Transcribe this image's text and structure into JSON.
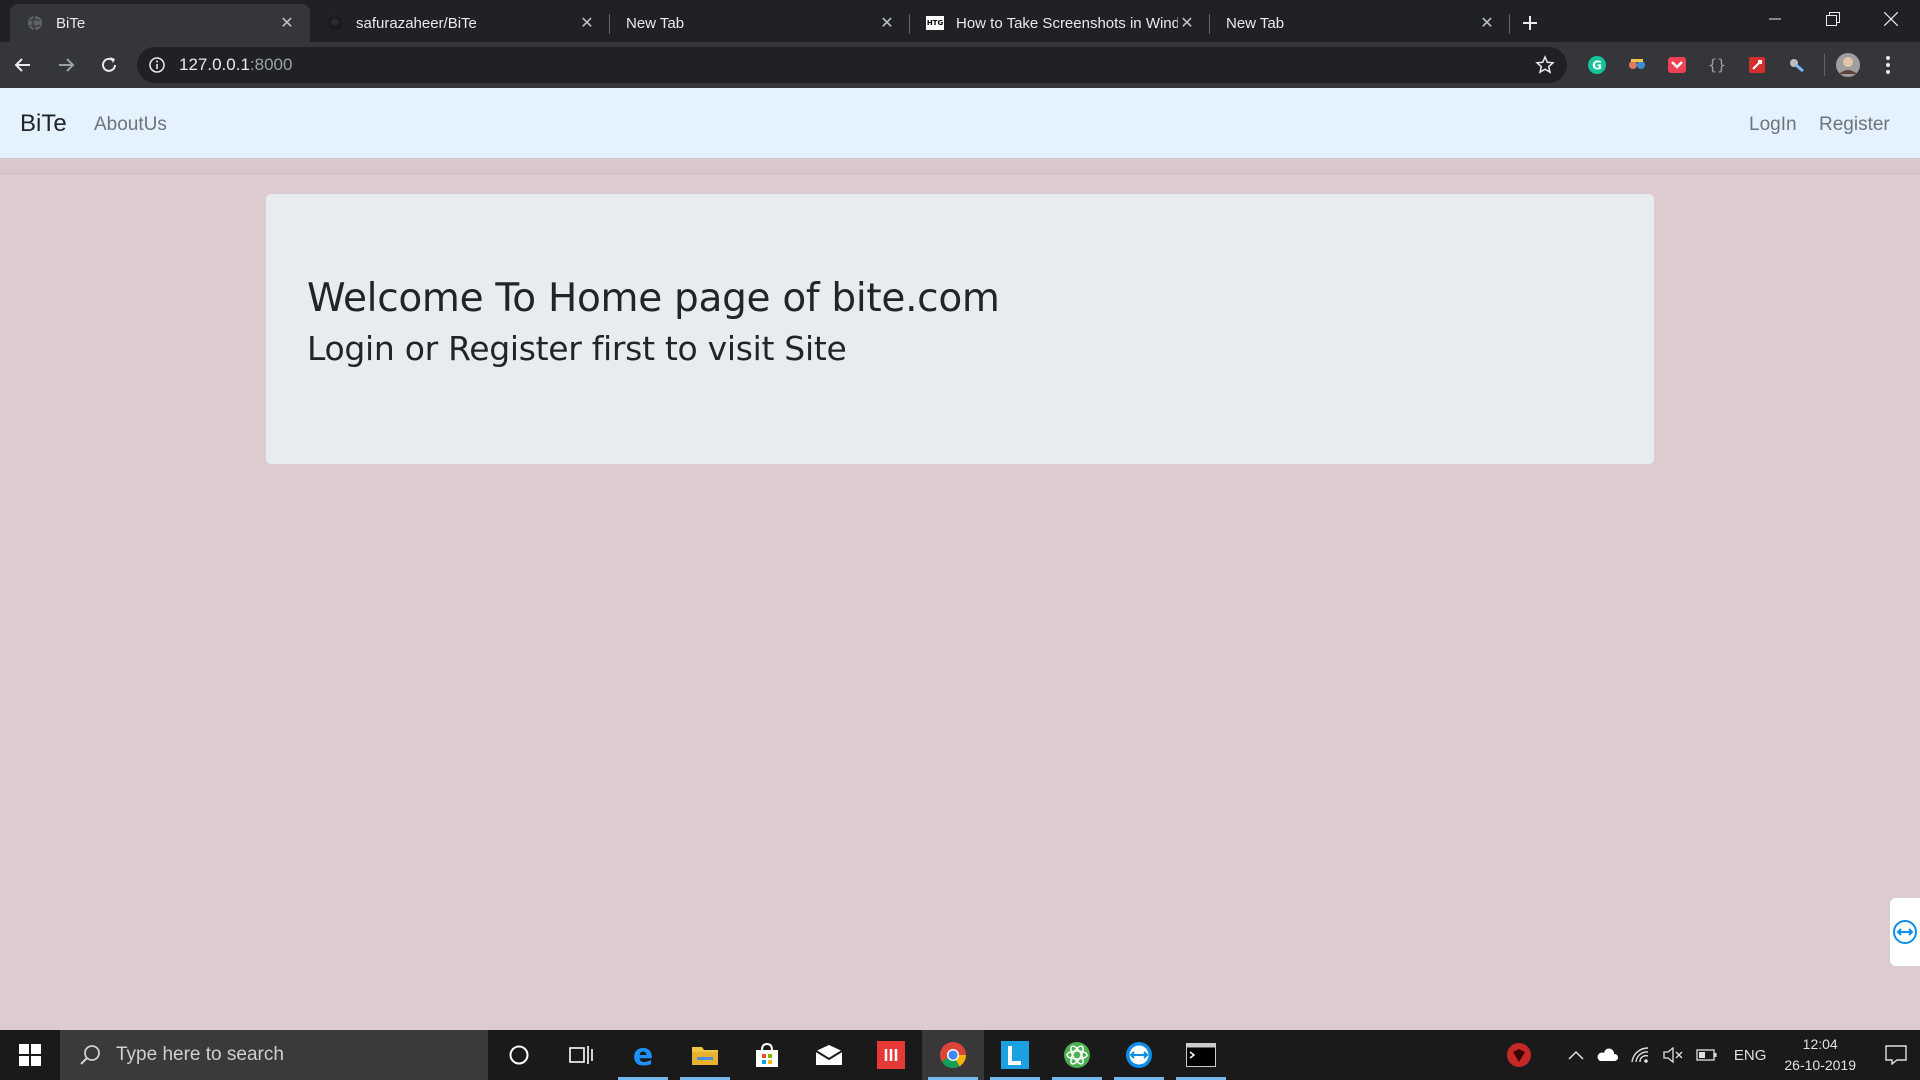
{
  "browser": {
    "tabs": [
      {
        "title": "BiTe",
        "favicon": "globe-icon",
        "active": true
      },
      {
        "title": "safurazaheer/BiTe",
        "favicon": "github-icon",
        "active": false
      },
      {
        "title": "New Tab",
        "favicon": "",
        "active": false
      },
      {
        "title": "How to Take Screenshots in Windows",
        "favicon": "htg-icon",
        "active": false
      },
      {
        "title": "New Tab",
        "favicon": "",
        "active": false
      }
    ],
    "htg_favicon_text": "HTG",
    "url_host": "127.0.0.1",
    "url_port": ":8000",
    "extensions": [
      "grammarly-icon",
      "extension-icon",
      "pocket-icon",
      "json-icon",
      "rocket-icon",
      "key-icon"
    ],
    "colors": {
      "tabstrip": "#202124",
      "toolbar": "#35363a",
      "text": "#e8eaed"
    }
  },
  "site": {
    "brand": "BiTe",
    "nav": {
      "about": "AboutUs",
      "login": "LogIn",
      "register": "Register"
    },
    "jumbotron": {
      "heading": "Welcome To Home page of bite.com",
      "subheading": "Login or Register first to visit Site"
    },
    "colors": {
      "navbar": "#e3f2fd",
      "background": "#dccccf",
      "jumbotron": "#e9ecef"
    }
  },
  "taskbar": {
    "search_placeholder": "Type here to search",
    "apps": [
      "cortana-icon",
      "task-view-icon",
      "edge-icon",
      "file-explorer-icon",
      "store-icon",
      "mail-icon",
      "red-app-icon",
      "chrome-icon",
      "l-app-icon",
      "atom-icon",
      "teamviewer-icon",
      "terminal-icon"
    ],
    "tray": {
      "language": "ENG",
      "time": "12:04",
      "date": "26-10-2019"
    }
  }
}
